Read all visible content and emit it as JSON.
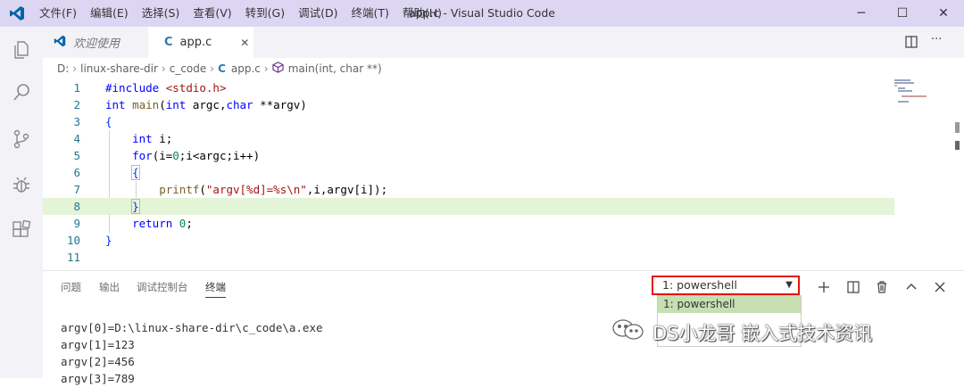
{
  "titlebar": {
    "menu": [
      "文件(F)",
      "编辑(E)",
      "选择(S)",
      "查看(V)",
      "转到(G)",
      "调试(D)",
      "终端(T)",
      "帮助(H)"
    ],
    "title": "app.c - Visual Studio Code",
    "controls": {
      "minimize": "─",
      "maximize": "☐",
      "close": "✕"
    }
  },
  "activity_bar": [
    "files-icon",
    "search-icon",
    "source-control-icon",
    "debug-icon",
    "extensions-icon"
  ],
  "tabs": [
    {
      "label": "欢迎使用",
      "icon": "vscode-logo-icon"
    },
    {
      "label": "app.c",
      "icon": "C",
      "close": "✕"
    }
  ],
  "tab_actions": {
    "more": "···"
  },
  "breadcrumb": [
    "D:",
    "linux-share-dir",
    "c_code",
    "app.c",
    "main(int, char **)"
  ],
  "breadcrumb_file_icon": "C",
  "editor": {
    "line_numbers": [
      "1",
      "2",
      "3",
      "4",
      "5",
      "6",
      "7",
      "8",
      "9",
      "10",
      "11"
    ],
    "highlighted_line": 8
  },
  "panel": {
    "tabs": [
      "问题",
      "输出",
      "调试控制台",
      "终端"
    ],
    "active_tab": "终端",
    "terminal_select": {
      "value": "1: powershell",
      "caret": "▼"
    },
    "dropdown_option": "1: powershell",
    "actions": [
      "plus-icon",
      "split-icon",
      "trash-icon",
      "chevron-up-icon",
      "close-icon"
    ],
    "terminal_lines": [
      "argv[0]=D:\\linux-share-dir\\c_code\\a.exe",
      "argv[1]=123",
      "argv[2]=456",
      "argv[3]=789"
    ]
  },
  "watermark": {
    "text": "DS小龙哥 嵌入式技术资讯"
  },
  "colors": {
    "titlebar": "#ddd6f3",
    "accent": "#007acc",
    "highlight": "#e4f4d7",
    "select_border": "#e51400"
  }
}
